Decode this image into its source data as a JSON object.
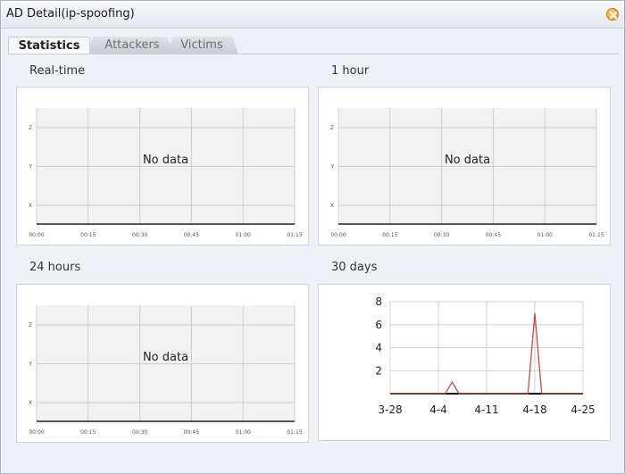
{
  "window": {
    "title": "AD Detail(ip-spoofing)"
  },
  "tabs": [
    {
      "label": "Statistics",
      "active": true
    },
    {
      "label": "Attackers",
      "active": false
    },
    {
      "label": "Victims",
      "active": false
    }
  ],
  "panels": {
    "realtime": {
      "title": "Real-time",
      "message": "No data",
      "y_ticks": [
        "Z",
        "Y",
        "X"
      ],
      "x_ticks": [
        "00:00",
        "00:15",
        "00:30",
        "00:45",
        "01:00",
        "01:15"
      ]
    },
    "hour": {
      "title": "1 hour",
      "message": "No data",
      "y_ticks": [
        "Z",
        "Y",
        "X"
      ],
      "x_ticks": [
        "00:00",
        "00:15",
        "00:30",
        "00:45",
        "01:00",
        "01:15"
      ]
    },
    "day": {
      "title": "24 hours",
      "message": "No data",
      "y_ticks": [
        "Z",
        "Y",
        "X"
      ],
      "x_ticks": [
        "00:00",
        "00:15",
        "00:30",
        "00:45",
        "01:00",
        "01:15"
      ]
    },
    "month": {
      "title": "30 days"
    }
  },
  "colors": {
    "line": "#c0504d",
    "grid": "#cfcfcf",
    "plot_bg": "#f2f2f2"
  },
  "chart_data": [
    {
      "type": "line",
      "title": "30 days",
      "xlabel": "",
      "ylabel": "",
      "x_ticks": [
        "3-28",
        "4-4",
        "4-11",
        "4-18",
        "4-25"
      ],
      "y_ticks": [
        2,
        4,
        6,
        8
      ],
      "ylim": [
        0,
        8
      ],
      "grid": true,
      "series": [
        {
          "points": [
            {
              "x": "3-28",
              "y": 0
            },
            {
              "x": "4-5",
              "y": 0
            },
            {
              "x": "4-6",
              "y": 1
            },
            {
              "x": "4-7",
              "y": 0
            },
            {
              "x": "4-17",
              "y": 0
            },
            {
              "x": "4-18",
              "y": 7
            },
            {
              "x": "4-19",
              "y": 0
            },
            {
              "x": "4-25",
              "y": 0
            }
          ]
        }
      ]
    }
  ]
}
